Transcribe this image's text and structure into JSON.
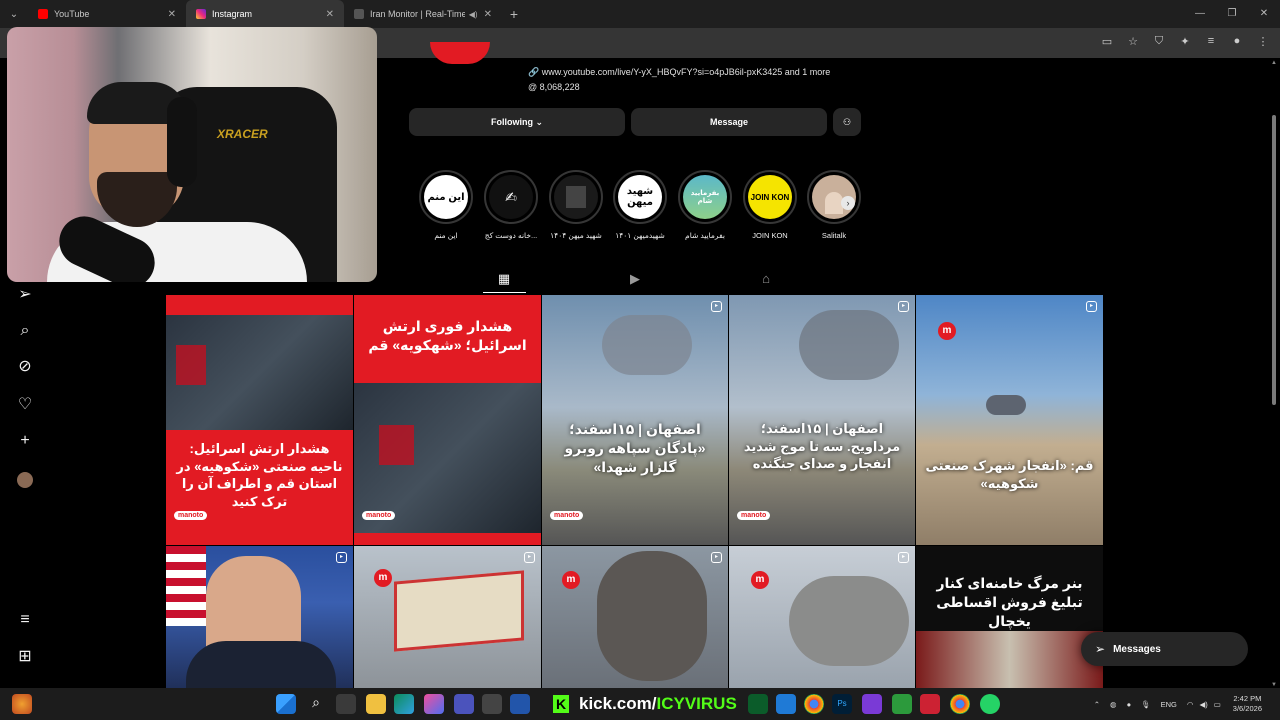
{
  "browser": {
    "tabs": [
      {
        "title": "YouTube",
        "color": "#ff0000"
      },
      {
        "title": "Instagram",
        "color": "#d62976"
      },
      {
        "title": "Iran Monitor | Real-Time Os",
        "color": "#444"
      }
    ]
  },
  "profile": {
    "link_text": "www.youtube.com/live/Y-yX_HBQvFY?si=o4pJB6il-pxK3425 and 1 more",
    "followers": "8,068,228",
    "following_label": "Following",
    "message_label": "Message"
  },
  "highlights": [
    {
      "label": "این منم",
      "inner_text": "این منم",
      "bg": "#ffffff",
      "fg": "#000000"
    },
    {
      "label": "خانه دوست کج...",
      "inner_text": "",
      "bg": "#111111",
      "fg": "#ffffff"
    },
    {
      "label": "شهید میهن ۱۴۰۴",
      "inner_text": "",
      "bg": "#1a1a1a",
      "fg": "#ffffff"
    },
    {
      "label": "شهیدمیهن ۱۴۰۱",
      "inner_text": "شهید میهن",
      "bg": "#ffffff",
      "fg": "#000000"
    },
    {
      "label": "بفرمایید شام",
      "inner_text": "بفرمایید شام",
      "bg": "#5bb8c9",
      "fg": "#ffffff"
    },
    {
      "label": "JOIN KON",
      "inner_text": "JOIN KON",
      "bg": "#f5e400",
      "fg": "#000000"
    },
    {
      "label": "Salitalk",
      "inner_text": "",
      "bg": "#c9b09b",
      "fg": "#000000"
    }
  ],
  "posts": [
    {
      "text": "هشدار ارتش اسرائیل: ناحیه صنعتی «شکوهیه» در استان قم و اطراف آن را ترک کنید",
      "badge": "manoto"
    },
    {
      "text": "هشدار فوری ارتش اسرائیل؛ «شهکویه» قم",
      "badge": "manoto"
    },
    {
      "text": "اصفهان | ۱۵اسفند؛ «پادگان سپاهه روبرو گلزار شهدا»",
      "badge": "manoto"
    },
    {
      "text": "اصفهان | ۱۵اسفند؛ مرداویج. سه تا موج شدید انفجار و صدای جنگنده",
      "badge": "manoto"
    },
    {
      "text": "قم: «انفجار شهرک صنعتی شکوهیه»",
      "badge": ""
    },
    {
      "text": "",
      "badge": ""
    },
    {
      "text": "",
      "badge": ""
    },
    {
      "text": "",
      "badge": ""
    },
    {
      "text": "",
      "badge": ""
    },
    {
      "text": "بنر مرگ خامنه‌ای کنار تبلیغ فروش اقساطی یخچال",
      "badge": ""
    }
  ],
  "messages_label": "Messages",
  "taskbar": {
    "kick_prefix": "kick.com/",
    "kick_user": "ICYVIRUS",
    "lang": "ENG",
    "time": "2:42 PM",
    "date": "3/6/2026"
  }
}
